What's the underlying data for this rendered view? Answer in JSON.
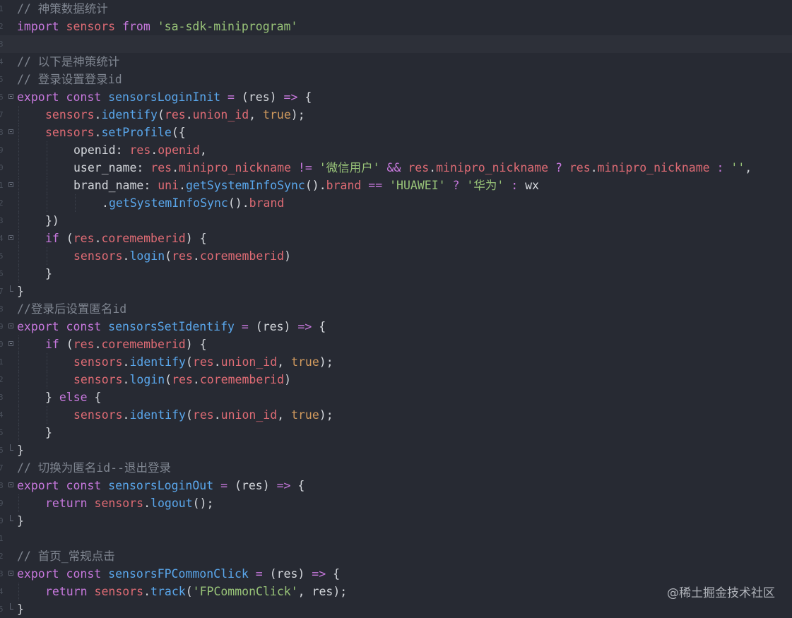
{
  "editor": {
    "gutter_numbers": [
      "1",
      "2",
      "3",
      "4",
      "5",
      "6",
      "7",
      "8",
      "9",
      "0",
      "1",
      "2",
      "3",
      "4",
      "5",
      "6",
      "7",
      "8",
      "9",
      "0",
      "1",
      "2",
      "3",
      "4",
      "5",
      "6",
      "7",
      "8",
      "9",
      "0",
      "1",
      "2",
      "3",
      "4",
      "5"
    ],
    "current_line_index": 2,
    "lines": [
      {
        "indent": 0,
        "fold": "",
        "tokens": [
          {
            "c": "t-comment",
            "t": "// 神策数据统计"
          }
        ]
      },
      {
        "indent": 0,
        "fold": "",
        "tokens": [
          {
            "c": "t-kw",
            "t": "import"
          },
          {
            "c": "t-plain",
            "t": " "
          },
          {
            "c": "t-ident",
            "t": "sensors"
          },
          {
            "c": "t-plain",
            "t": " "
          },
          {
            "c": "t-kw",
            "t": "from"
          },
          {
            "c": "t-plain",
            "t": " "
          },
          {
            "c": "t-str",
            "t": "'sa-sdk-miniprogram'"
          }
        ]
      },
      {
        "indent": 0,
        "fold": "",
        "tokens": []
      },
      {
        "indent": 0,
        "fold": "",
        "tokens": [
          {
            "c": "t-comment",
            "t": "// 以下是神策统计"
          }
        ]
      },
      {
        "indent": 0,
        "fold": "",
        "tokens": [
          {
            "c": "t-comment",
            "t": "// 登录设置登录id"
          }
        ]
      },
      {
        "indent": 0,
        "fold": "open",
        "tokens": [
          {
            "c": "t-kw",
            "t": "export"
          },
          {
            "c": "t-plain",
            "t": " "
          },
          {
            "c": "t-kw",
            "t": "const"
          },
          {
            "c": "t-plain",
            "t": " "
          },
          {
            "c": "t-fn",
            "t": "sensorsLoginInit"
          },
          {
            "c": "t-plain",
            "t": " "
          },
          {
            "c": "t-op",
            "t": "="
          },
          {
            "c": "t-plain",
            "t": " (res) "
          },
          {
            "c": "t-op",
            "t": "=>"
          },
          {
            "c": "t-plain",
            "t": " {"
          }
        ]
      },
      {
        "indent": 1,
        "fold": "",
        "tokens": [
          {
            "c": "t-ident",
            "t": "sensors"
          },
          {
            "c": "t-plain",
            "t": "."
          },
          {
            "c": "t-fn",
            "t": "identify"
          },
          {
            "c": "t-plain",
            "t": "("
          },
          {
            "c": "t-ident",
            "t": "res"
          },
          {
            "c": "t-plain",
            "t": "."
          },
          {
            "c": "t-ident",
            "t": "union_id"
          },
          {
            "c": "t-plain",
            "t": ", "
          },
          {
            "c": "t-bool",
            "t": "true"
          },
          {
            "c": "t-plain",
            "t": ");"
          }
        ]
      },
      {
        "indent": 1,
        "fold": "open",
        "tokens": [
          {
            "c": "t-ident",
            "t": "sensors"
          },
          {
            "c": "t-plain",
            "t": "."
          },
          {
            "c": "t-fn",
            "t": "setProfile"
          },
          {
            "c": "t-plain",
            "t": "({"
          }
        ]
      },
      {
        "indent": 2,
        "fold": "",
        "tokens": [
          {
            "c": "t-plain",
            "t": "openid: "
          },
          {
            "c": "t-ident",
            "t": "res"
          },
          {
            "c": "t-plain",
            "t": "."
          },
          {
            "c": "t-ident",
            "t": "openid"
          },
          {
            "c": "t-plain",
            "t": ","
          }
        ]
      },
      {
        "indent": 2,
        "fold": "",
        "tokens": [
          {
            "c": "t-plain",
            "t": "user_name: "
          },
          {
            "c": "t-ident",
            "t": "res"
          },
          {
            "c": "t-plain",
            "t": "."
          },
          {
            "c": "t-ident",
            "t": "minipro_nickname"
          },
          {
            "c": "t-plain",
            "t": " "
          },
          {
            "c": "t-op",
            "t": "!="
          },
          {
            "c": "t-plain",
            "t": " "
          },
          {
            "c": "t-str",
            "t": "'微信用户'"
          },
          {
            "c": "t-plain",
            "t": " "
          },
          {
            "c": "t-op",
            "t": "&&"
          },
          {
            "c": "t-plain",
            "t": " "
          },
          {
            "c": "t-ident",
            "t": "res"
          },
          {
            "c": "t-plain",
            "t": "."
          },
          {
            "c": "t-ident",
            "t": "minipro_nickname"
          },
          {
            "c": "t-plain",
            "t": " "
          },
          {
            "c": "t-op",
            "t": "?"
          },
          {
            "c": "t-plain",
            "t": " "
          },
          {
            "c": "t-ident",
            "t": "res"
          },
          {
            "c": "t-plain",
            "t": "."
          },
          {
            "c": "t-ident",
            "t": "minipro_nickname"
          },
          {
            "c": "t-plain",
            "t": " "
          },
          {
            "c": "t-op",
            "t": ":"
          },
          {
            "c": "t-plain",
            "t": " "
          },
          {
            "c": "t-str",
            "t": "''"
          },
          {
            "c": "t-plain",
            "t": ","
          }
        ]
      },
      {
        "indent": 2,
        "fold": "open",
        "tokens": [
          {
            "c": "t-plain",
            "t": "brand_name: "
          },
          {
            "c": "t-ident",
            "t": "uni"
          },
          {
            "c": "t-plain",
            "t": "."
          },
          {
            "c": "t-fn",
            "t": "getSystemInfoSync"
          },
          {
            "c": "t-plain",
            "t": "()."
          },
          {
            "c": "t-ident",
            "t": "brand"
          },
          {
            "c": "t-plain",
            "t": " "
          },
          {
            "c": "t-op",
            "t": "=="
          },
          {
            "c": "t-plain",
            "t": " "
          },
          {
            "c": "t-str",
            "t": "'HUAWEI'"
          },
          {
            "c": "t-plain",
            "t": " "
          },
          {
            "c": "t-op",
            "t": "?"
          },
          {
            "c": "t-plain",
            "t": " "
          },
          {
            "c": "t-str",
            "t": "'华为'"
          },
          {
            "c": "t-plain",
            "t": " "
          },
          {
            "c": "t-op",
            "t": ":"
          },
          {
            "c": "t-plain",
            "t": " wx"
          }
        ]
      },
      {
        "indent": 3,
        "fold": "",
        "tokens": [
          {
            "c": "t-plain",
            "t": "."
          },
          {
            "c": "t-fn",
            "t": "getSystemInfoSync"
          },
          {
            "c": "t-plain",
            "t": "()."
          },
          {
            "c": "t-ident",
            "t": "brand"
          }
        ]
      },
      {
        "indent": 1,
        "fold": "",
        "tokens": [
          {
            "c": "t-plain",
            "t": "})"
          }
        ]
      },
      {
        "indent": 1,
        "fold": "open",
        "tokens": [
          {
            "c": "t-kw",
            "t": "if"
          },
          {
            "c": "t-plain",
            "t": " ("
          },
          {
            "c": "t-ident",
            "t": "res"
          },
          {
            "c": "t-plain",
            "t": "."
          },
          {
            "c": "t-ident",
            "t": "corememberid"
          },
          {
            "c": "t-plain",
            "t": ") {"
          }
        ]
      },
      {
        "indent": 2,
        "fold": "",
        "tokens": [
          {
            "c": "t-ident",
            "t": "sensors"
          },
          {
            "c": "t-plain",
            "t": "."
          },
          {
            "c": "t-fn",
            "t": "login"
          },
          {
            "c": "t-plain",
            "t": "("
          },
          {
            "c": "t-ident",
            "t": "res"
          },
          {
            "c": "t-plain",
            "t": "."
          },
          {
            "c": "t-ident",
            "t": "corememberid"
          },
          {
            "c": "t-plain",
            "t": ")"
          }
        ]
      },
      {
        "indent": 1,
        "fold": "",
        "tokens": [
          {
            "c": "t-plain",
            "t": "}"
          }
        ]
      },
      {
        "indent": 0,
        "fold": "end",
        "tokens": [
          {
            "c": "t-plain",
            "t": "}"
          }
        ]
      },
      {
        "indent": 0,
        "fold": "",
        "tokens": [
          {
            "c": "t-comment",
            "t": "//登录后设置匿名id"
          }
        ]
      },
      {
        "indent": 0,
        "fold": "open",
        "tokens": [
          {
            "c": "t-kw",
            "t": "export"
          },
          {
            "c": "t-plain",
            "t": " "
          },
          {
            "c": "t-kw",
            "t": "const"
          },
          {
            "c": "t-plain",
            "t": " "
          },
          {
            "c": "t-fn",
            "t": "sensorsSetIdentify"
          },
          {
            "c": "t-plain",
            "t": " "
          },
          {
            "c": "t-op",
            "t": "="
          },
          {
            "c": "t-plain",
            "t": " (res) "
          },
          {
            "c": "t-op",
            "t": "=>"
          },
          {
            "c": "t-plain",
            "t": " {"
          }
        ]
      },
      {
        "indent": 1,
        "fold": "open",
        "tokens": [
          {
            "c": "t-kw",
            "t": "if"
          },
          {
            "c": "t-plain",
            "t": " ("
          },
          {
            "c": "t-ident",
            "t": "res"
          },
          {
            "c": "t-plain",
            "t": "."
          },
          {
            "c": "t-ident",
            "t": "corememberid"
          },
          {
            "c": "t-plain",
            "t": ") {"
          }
        ]
      },
      {
        "indent": 2,
        "fold": "",
        "tokens": [
          {
            "c": "t-ident",
            "t": "sensors"
          },
          {
            "c": "t-plain",
            "t": "."
          },
          {
            "c": "t-fn",
            "t": "identify"
          },
          {
            "c": "t-plain",
            "t": "("
          },
          {
            "c": "t-ident",
            "t": "res"
          },
          {
            "c": "t-plain",
            "t": "."
          },
          {
            "c": "t-ident",
            "t": "union_id"
          },
          {
            "c": "t-plain",
            "t": ", "
          },
          {
            "c": "t-bool",
            "t": "true"
          },
          {
            "c": "t-plain",
            "t": ");"
          }
        ]
      },
      {
        "indent": 2,
        "fold": "",
        "tokens": [
          {
            "c": "t-ident",
            "t": "sensors"
          },
          {
            "c": "t-plain",
            "t": "."
          },
          {
            "c": "t-fn",
            "t": "login"
          },
          {
            "c": "t-plain",
            "t": "("
          },
          {
            "c": "t-ident",
            "t": "res"
          },
          {
            "c": "t-plain",
            "t": "."
          },
          {
            "c": "t-ident",
            "t": "corememberid"
          },
          {
            "c": "t-plain",
            "t": ")"
          }
        ]
      },
      {
        "indent": 1,
        "fold": "",
        "tokens": [
          {
            "c": "t-plain",
            "t": "} "
          },
          {
            "c": "t-kw",
            "t": "else"
          },
          {
            "c": "t-plain",
            "t": " {"
          }
        ]
      },
      {
        "indent": 2,
        "fold": "",
        "tokens": [
          {
            "c": "t-ident",
            "t": "sensors"
          },
          {
            "c": "t-plain",
            "t": "."
          },
          {
            "c": "t-fn",
            "t": "identify"
          },
          {
            "c": "t-plain",
            "t": "("
          },
          {
            "c": "t-ident",
            "t": "res"
          },
          {
            "c": "t-plain",
            "t": "."
          },
          {
            "c": "t-ident",
            "t": "union_id"
          },
          {
            "c": "t-plain",
            "t": ", "
          },
          {
            "c": "t-bool",
            "t": "true"
          },
          {
            "c": "t-plain",
            "t": ");"
          }
        ]
      },
      {
        "indent": 1,
        "fold": "",
        "tokens": [
          {
            "c": "t-plain",
            "t": "}"
          }
        ]
      },
      {
        "indent": 0,
        "fold": "end",
        "tokens": [
          {
            "c": "t-plain",
            "t": "}"
          }
        ]
      },
      {
        "indent": 0,
        "fold": "",
        "tokens": [
          {
            "c": "t-comment",
            "t": "// 切换为匿名id--退出登录"
          }
        ]
      },
      {
        "indent": 0,
        "fold": "open",
        "tokens": [
          {
            "c": "t-kw",
            "t": "export"
          },
          {
            "c": "t-plain",
            "t": " "
          },
          {
            "c": "t-kw",
            "t": "const"
          },
          {
            "c": "t-plain",
            "t": " "
          },
          {
            "c": "t-fn",
            "t": "sensorsLoginOut"
          },
          {
            "c": "t-plain",
            "t": " "
          },
          {
            "c": "t-op",
            "t": "="
          },
          {
            "c": "t-plain",
            "t": " (res) "
          },
          {
            "c": "t-op",
            "t": "=>"
          },
          {
            "c": "t-plain",
            "t": " {"
          }
        ]
      },
      {
        "indent": 1,
        "fold": "",
        "tokens": [
          {
            "c": "t-kw",
            "t": "return"
          },
          {
            "c": "t-plain",
            "t": " "
          },
          {
            "c": "t-ident",
            "t": "sensors"
          },
          {
            "c": "t-plain",
            "t": "."
          },
          {
            "c": "t-fn",
            "t": "logout"
          },
          {
            "c": "t-plain",
            "t": "();"
          }
        ]
      },
      {
        "indent": 0,
        "fold": "end",
        "tokens": [
          {
            "c": "t-plain",
            "t": "}"
          }
        ]
      },
      {
        "indent": 0,
        "fold": "",
        "tokens": []
      },
      {
        "indent": 0,
        "fold": "",
        "tokens": [
          {
            "c": "t-comment",
            "t": "// 首页_常规点击"
          }
        ]
      },
      {
        "indent": 0,
        "fold": "open",
        "tokens": [
          {
            "c": "t-kw",
            "t": "export"
          },
          {
            "c": "t-plain",
            "t": " "
          },
          {
            "c": "t-kw",
            "t": "const"
          },
          {
            "c": "t-plain",
            "t": " "
          },
          {
            "c": "t-fn",
            "t": "sensorsFPCommonClick"
          },
          {
            "c": "t-plain",
            "t": " "
          },
          {
            "c": "t-op",
            "t": "="
          },
          {
            "c": "t-plain",
            "t": " (res) "
          },
          {
            "c": "t-op",
            "t": "=>"
          },
          {
            "c": "t-plain",
            "t": " {"
          }
        ]
      },
      {
        "indent": 1,
        "fold": "",
        "tokens": [
          {
            "c": "t-kw",
            "t": "return"
          },
          {
            "c": "t-plain",
            "t": " "
          },
          {
            "c": "t-ident",
            "t": "sensors"
          },
          {
            "c": "t-plain",
            "t": "."
          },
          {
            "c": "t-fn",
            "t": "track"
          },
          {
            "c": "t-plain",
            "t": "("
          },
          {
            "c": "t-str",
            "t": "'FPCommonClick'"
          },
          {
            "c": "t-plain",
            "t": ", res);"
          }
        ]
      },
      {
        "indent": 0,
        "fold": "end",
        "tokens": [
          {
            "c": "t-plain",
            "t": "}"
          }
        ]
      }
    ]
  },
  "watermark": "@稀土掘金技术社区"
}
